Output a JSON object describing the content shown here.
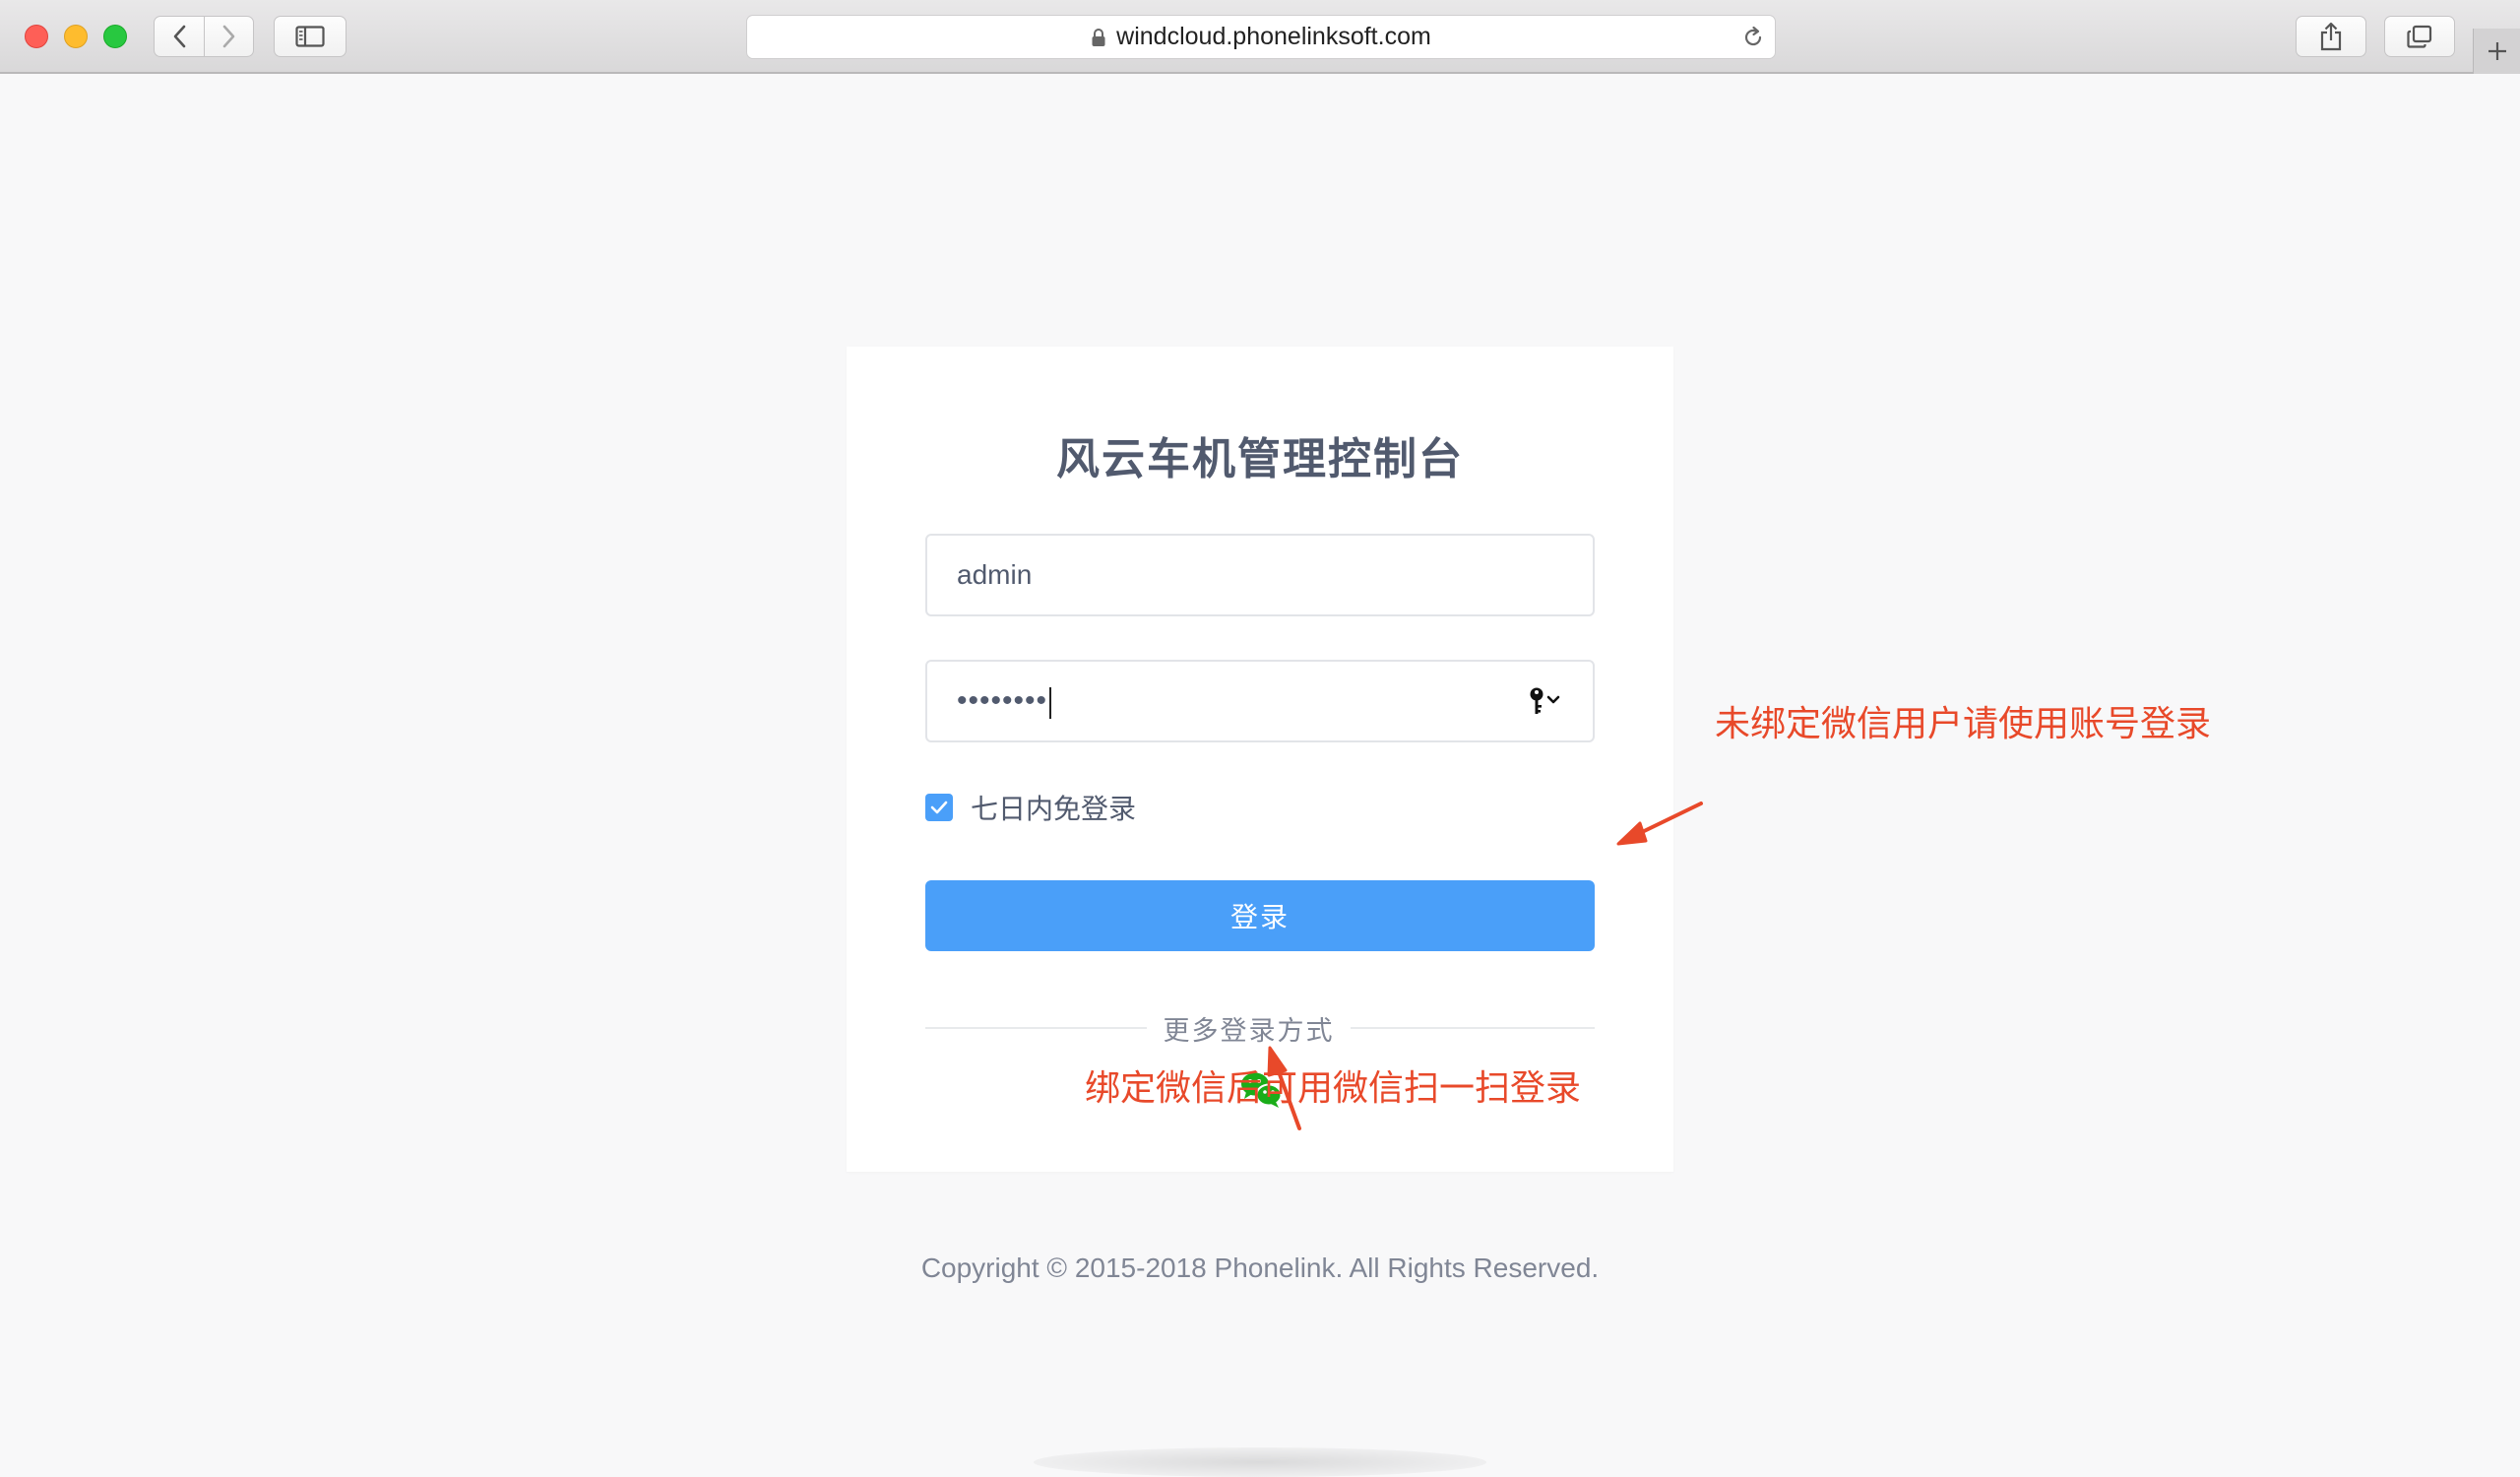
{
  "browser": {
    "url": "windcloud.phonelinksoft.com"
  },
  "login": {
    "title": "风云车机管理控制台",
    "username_value": "admin",
    "password_mask": "••••••••",
    "remember_label": "七日内免登录",
    "remember_checked": true,
    "submit_label": "登录",
    "more_label": "更多登录方式",
    "alt_login_icon": "wechat-icon"
  },
  "footer": {
    "copyright": "Copyright © 2015-2018 Phonelink. All Rights Reserved."
  },
  "annotations": {
    "right_note": "未绑定微信用户请使用账号登录",
    "bottom_note": "绑定微信后可用微信扫一扫登录"
  },
  "colors": {
    "primary": "#4a9ff9",
    "wechat": "#1aad19",
    "annotation": "#e8492a"
  }
}
